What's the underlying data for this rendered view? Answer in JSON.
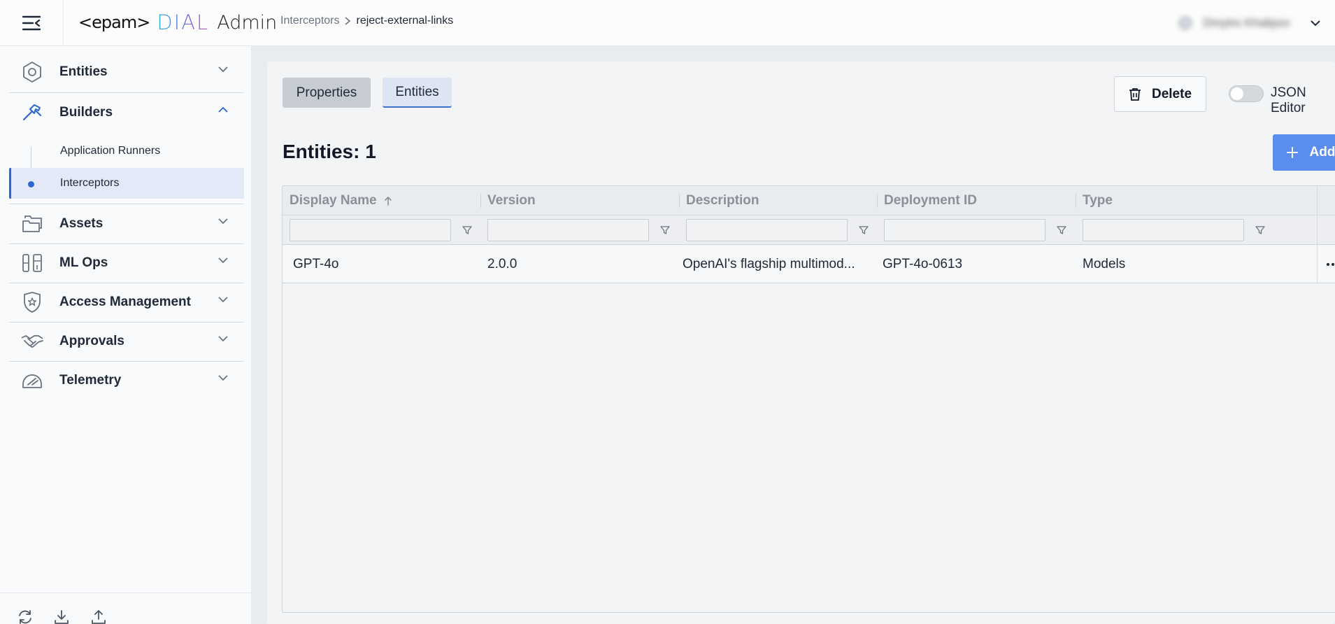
{
  "header": {
    "logo": {
      "epam": "<epam>",
      "dial": "DIAL",
      "admin": "Admin"
    },
    "breadcrumb": {
      "parent": "Interceptors",
      "current": "reject-external-links"
    },
    "user": {
      "name": "Dmytro Khalipov"
    }
  },
  "sidebar": {
    "groups": [
      {
        "label": "Entities",
        "icon": "hexagon-icon",
        "expanded": false
      },
      {
        "label": "Builders",
        "icon": "hammer-icon",
        "expanded": true
      },
      {
        "label": "Assets",
        "icon": "folders-icon",
        "expanded": false
      },
      {
        "label": "ML Ops",
        "icon": "test-tubes-icon",
        "expanded": false
      },
      {
        "label": "Access Management",
        "icon": "shield-star-icon",
        "expanded": false
      },
      {
        "label": "Approvals",
        "icon": "handshake-icon",
        "expanded": false
      },
      {
        "label": "Telemetry",
        "icon": "gauge-icon",
        "expanded": false
      }
    ],
    "builders_items": [
      {
        "label": "Application Runners",
        "active": false
      },
      {
        "label": "Interceptors",
        "active": true
      }
    ],
    "bottom_icons": [
      "refresh-icon",
      "download-icon",
      "upload-icon"
    ]
  },
  "main": {
    "tabs": [
      {
        "label": "Properties",
        "selected": false
      },
      {
        "label": "Entities",
        "selected": true
      }
    ],
    "delete_label": "Delete",
    "json_editor_label": "JSON Editor",
    "json_editor_enabled": false,
    "title": "Entities: 1",
    "add_label": "Add",
    "grid": {
      "columns": [
        "Display Name",
        "Version",
        "Description",
        "Deployment ID",
        "Type"
      ],
      "sort": {
        "column": "Display Name",
        "direction": "asc"
      },
      "rows": [
        {
          "display_name": "GPT-4o",
          "version": "2.0.0",
          "description": "OpenAI's flagship multimod...",
          "deployment_id": "GPT-4o-0613",
          "type": "Models"
        }
      ]
    }
  },
  "colors": {
    "accent": "#2c66d0",
    "add_button": "#5b8def",
    "active_item_bg": "#e3e9f6"
  }
}
